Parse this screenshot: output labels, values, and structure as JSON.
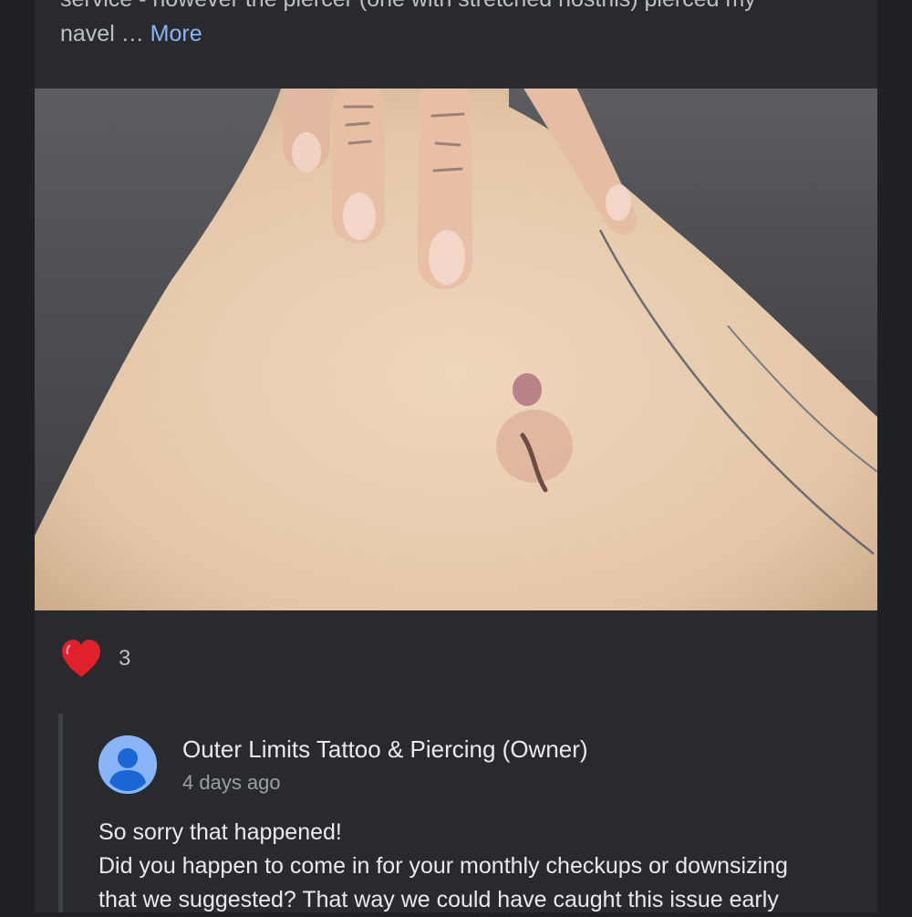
{
  "review": {
    "text_line1": "service - however the piercer (one with stretched nostrils) pierced my",
    "text_line2": "navel …",
    "more_label": "More"
  },
  "photo": {
    "icon": "review-photo"
  },
  "reactions": {
    "icon": "heart-icon",
    "count": "3"
  },
  "reply": {
    "author": "Outer Limits Tattoo & Piercing (Owner)",
    "date": "4 days ago",
    "avatar_icon": "person-icon",
    "line1": "So sorry that happened!",
    "line2": "Did you happen to come in for your monthly checkups or downsizing",
    "line3": "that we suggested? That way we could have caught this issue early"
  },
  "colors": {
    "background": "#202124",
    "card": "#292a2d",
    "link": "#8ab4f8",
    "heart": "#e0202b"
  }
}
